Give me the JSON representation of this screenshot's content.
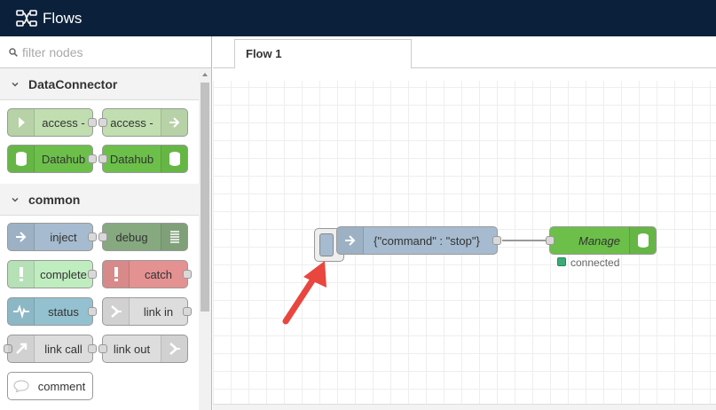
{
  "app": {
    "title": "Flows"
  },
  "palette": {
    "filter_placeholder": "filter nodes",
    "categories": [
      {
        "name": "DataConnector",
        "nodes": [
          {
            "label": "access -",
            "color": "#c0deaf"
          },
          {
            "label": "access -",
            "color": "#c0deaf"
          },
          {
            "label": "Datahub",
            "color": "#6cc04a"
          },
          {
            "label": "Datahub",
            "color": "#6cc04a"
          }
        ]
      },
      {
        "name": "common",
        "nodes": [
          {
            "label": "inject",
            "color": "#a6bbcf"
          },
          {
            "label": "debug",
            "color": "#87a980"
          },
          {
            "label": "complete",
            "color": "#c0edc0"
          },
          {
            "label": "catch",
            "color": "#e49191"
          },
          {
            "label": "status",
            "color": "#94c1d0"
          },
          {
            "label": "link in",
            "color": "#dddddd"
          },
          {
            "label": "link call",
            "color": "#dddddd"
          },
          {
            "label": "link out",
            "color": "#dddddd"
          },
          {
            "label": "comment",
            "color": "#ffffff"
          }
        ]
      }
    ]
  },
  "workspace": {
    "tabs": [
      {
        "label": "Flow 1"
      }
    ],
    "nodes": {
      "inject": {
        "label": "{\"command\" : \"stop\"}",
        "color": "#a6bbcf"
      },
      "manage": {
        "label": "Manage",
        "color": "#6cc04a",
        "status": "connected",
        "status_color": "#3faa75"
      }
    }
  },
  "annotation": {
    "arrow_color": "#e8463f"
  }
}
